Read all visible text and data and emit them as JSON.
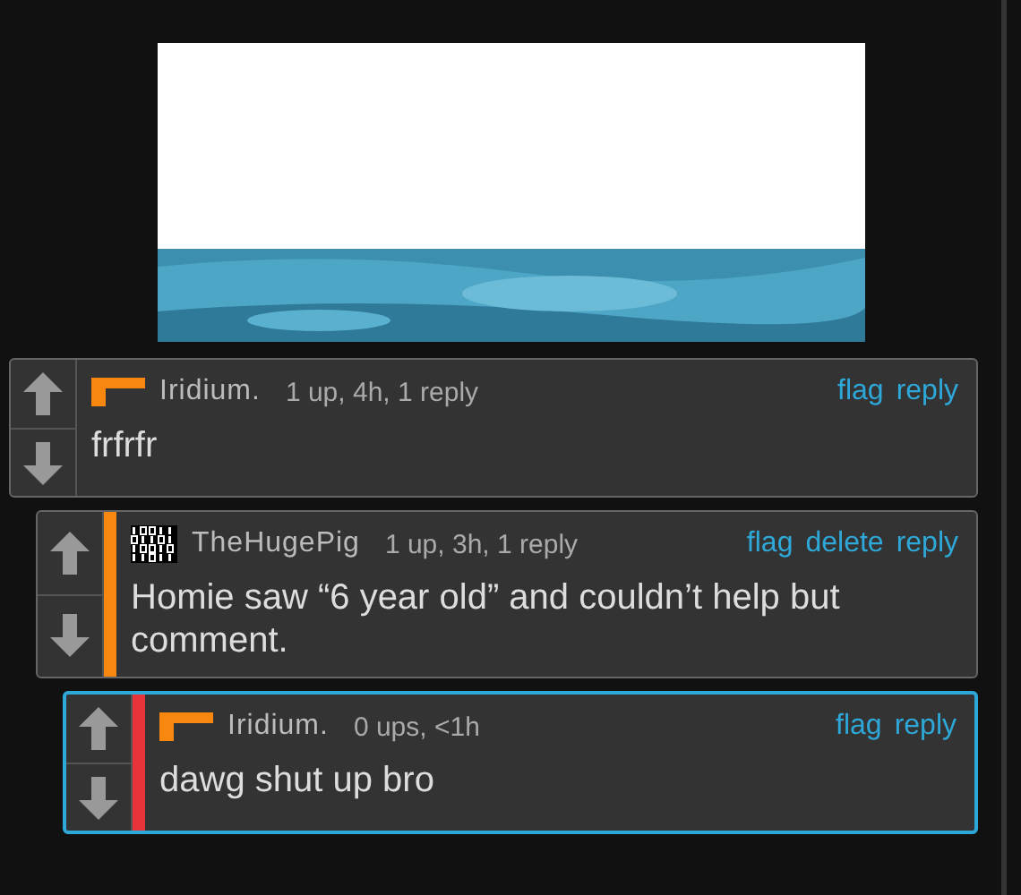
{
  "comments": [
    {
      "username": "Iridium.",
      "kind": "orange-mark",
      "meta": "1 up, 4h, 1 reply",
      "actions": [
        "flag",
        "reply"
      ],
      "text": "frfrfr",
      "selected": false,
      "replies": [
        {
          "username": "TheHugePig",
          "kind": "bit-grid",
          "meta": "1 up, 3h, 1 reply",
          "actions": [
            "flag",
            "delete",
            "reply"
          ],
          "text": "Homie saw “6 year old” and couldn’t help but comment.",
          "color": "#f7870f",
          "selected": false,
          "replies": [
            {
              "username": "Iridium.",
              "kind": "orange-mark",
              "meta": "0 ups, <1h",
              "actions": [
                "flag",
                "reply"
              ],
              "text": "dawg shut up bro",
              "color": "#e8333a",
              "selected": true
            }
          ]
        }
      ]
    }
  ]
}
